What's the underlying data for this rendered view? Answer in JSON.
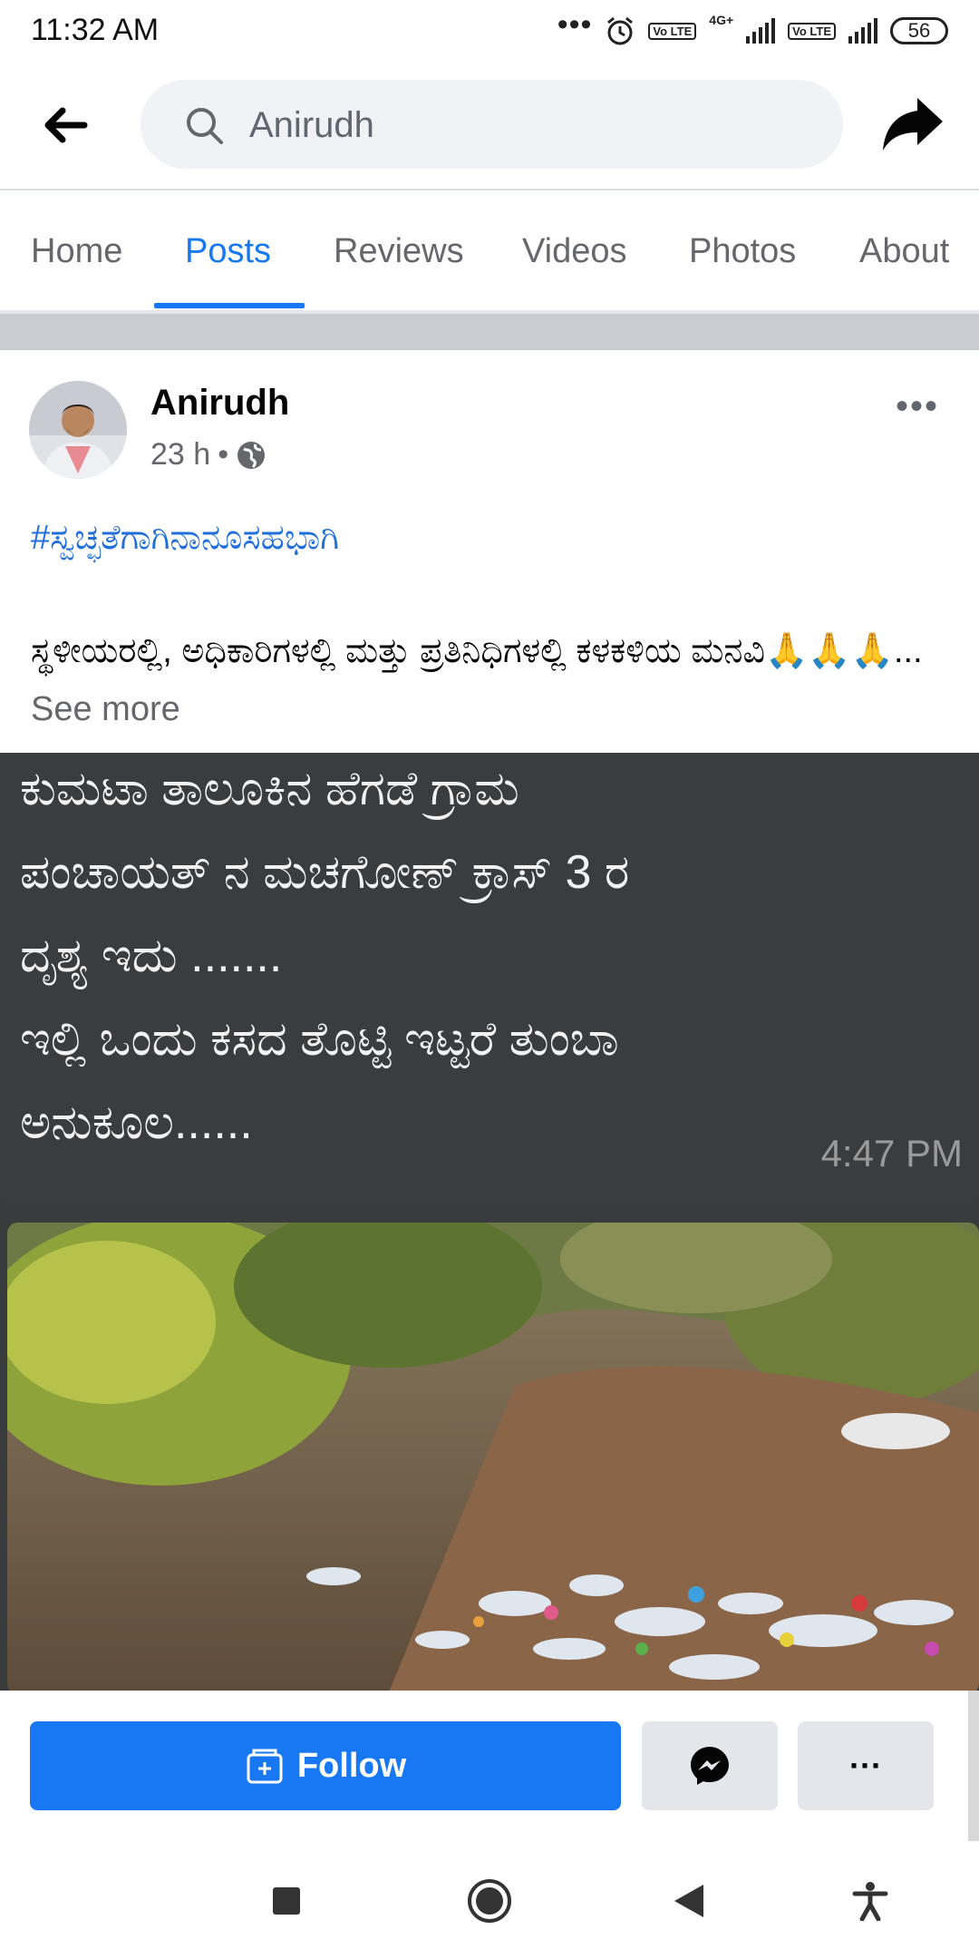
{
  "status_bar": {
    "time": "11:32 AM",
    "dots": "•••",
    "network": "4G+",
    "volte_1": "Vo LTE",
    "volte_2": "Vo LTE",
    "battery": "56"
  },
  "search": {
    "value": "Anirudh"
  },
  "tabs": [
    "Home",
    "Posts",
    "Reviews",
    "Videos",
    "Photos",
    "About"
  ],
  "post": {
    "author": "Anirudh",
    "time": "23 h",
    "separator": "•",
    "hashtag": "#ಸ್ವಚ್ಛತೆಗಾಗಿನಾನೂಸಹಭಾಗಿ",
    "text": "ಸ್ಥಳೀಯರಲ್ಲಿ, ಅಧಿಕಾರಿಗಳಲ್ಲಿ ಮತ್ತು ಪ್ರತಿನಿಧಿಗಳಲ್ಲಿ ಕಳಕಳಿಯ ಮನವಿ🙏🙏🙏...",
    "see_more": "See more",
    "image_text": "ಕುಮಟಾ ತಾಲೂಕಿನ ಹೆಗಡೆ ಗ್ರಾಮ\nಪಂಚಾಯತ್ ನ ಮಚಗೋಣ್ ಕ್ರಾಸ್ 3 ರ\nದೃಶ್ಯ ಇದು .......\nಇಲ್ಲಿ ಒಂದು ಕಸದ ತೊಟ್ಟಿ ಇಟ್ಟರೆ ತುಂಬಾ\nಅನುಕೂಲ......",
    "image_time": "4:47 PM"
  },
  "actions": {
    "follow": "Follow",
    "more": "···"
  },
  "colors": {
    "accent": "#1877f2",
    "button_grey": "#e4e6eb"
  },
  "icons": [
    "back-arrow-icon",
    "search-icon",
    "share-icon",
    "globe-icon",
    "more-icon",
    "follow-page-icon",
    "messenger-icon",
    "nav-square-icon",
    "nav-home-icon",
    "nav-back-icon",
    "accessibility-icon"
  ]
}
